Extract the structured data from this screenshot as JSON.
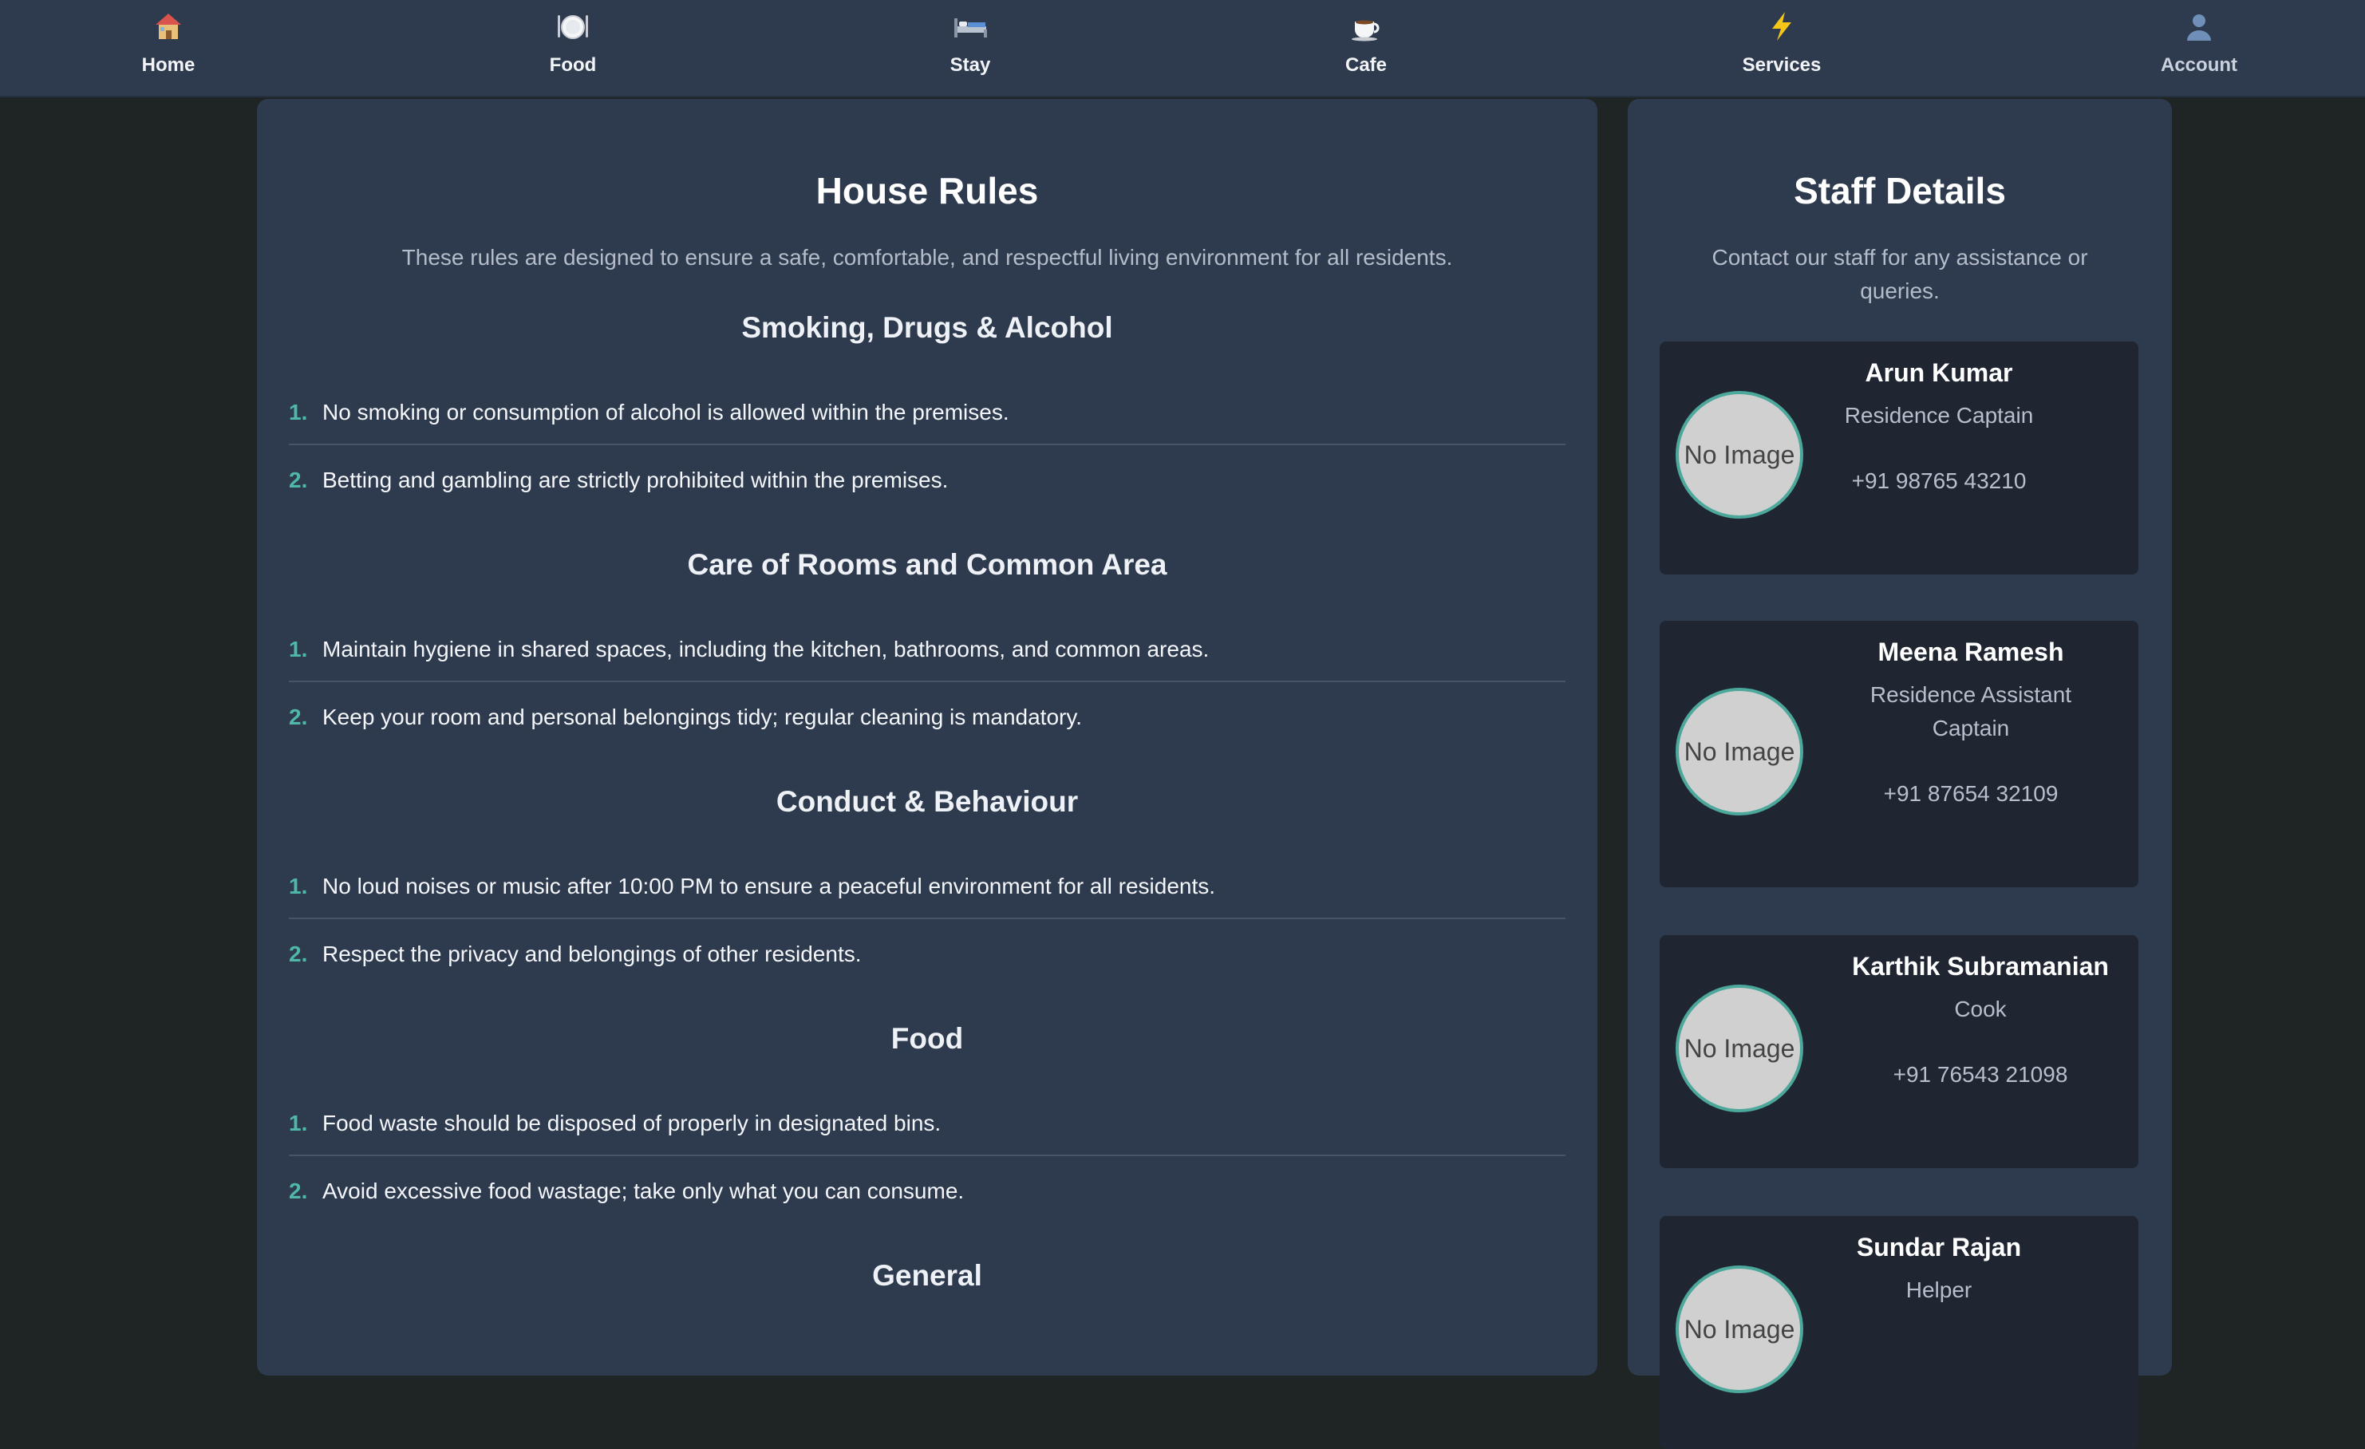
{
  "nav": {
    "items": [
      {
        "label": "Home",
        "icon": "home-icon"
      },
      {
        "label": "Food",
        "icon": "plate-icon"
      },
      {
        "label": "Stay",
        "icon": "bed-icon"
      },
      {
        "label": "Cafe",
        "icon": "coffee-icon"
      },
      {
        "label": "Services",
        "icon": "lightning-icon"
      },
      {
        "label": "Account",
        "icon": "user-icon"
      }
    ]
  },
  "rules": {
    "title": "House Rules",
    "subtitle": "These rules are designed to ensure a safe, comfortable, and respectful living environment for all residents.",
    "sections": [
      {
        "title": "Smoking, Drugs & Alcohol",
        "items": [
          {
            "num": "1.",
            "text": "No smoking or consumption of alcohol is allowed within the premises."
          },
          {
            "num": "2.",
            "text": "Betting and gambling are strictly prohibited within the premises."
          }
        ]
      },
      {
        "title": "Care of Rooms and Common Area",
        "items": [
          {
            "num": "1.",
            "text": "Maintain hygiene in shared spaces, including the kitchen, bathrooms, and common areas."
          },
          {
            "num": "2.",
            "text": "Keep your room and personal belongings tidy; regular cleaning is mandatory."
          }
        ]
      },
      {
        "title": "Conduct & Behaviour",
        "items": [
          {
            "num": "1.",
            "text": "No loud noises or music after 10:00 PM to ensure a peaceful environment for all residents."
          },
          {
            "num": "2.",
            "text": "Respect the privacy and belongings of other residents."
          }
        ]
      },
      {
        "title": "Food",
        "items": [
          {
            "num": "1.",
            "text": "Food waste should be disposed of properly in designated bins."
          },
          {
            "num": "2.",
            "text": "Avoid excessive food wastage; take only what you can consume."
          }
        ]
      },
      {
        "title": "General",
        "items": []
      }
    ]
  },
  "staff": {
    "title": "Staff Details",
    "subtitle": "Contact our staff for any assistance or queries.",
    "members": [
      {
        "name": "Arun Kumar",
        "role": "Residence Captain",
        "phone": "+91 98765 43210",
        "avatar_text": "No Image"
      },
      {
        "name": "Meena Ramesh",
        "role": "Residence Assistant Captain",
        "phone": "+91 87654 32109",
        "avatar_text": "No Image"
      },
      {
        "name": "Karthik Subramanian",
        "role": "Cook",
        "phone": "+91 76543 21098",
        "avatar_text": "No Image"
      },
      {
        "name": "Sundar Rajan",
        "role": "Helper",
        "phone": "",
        "avatar_text": "No Image"
      }
    ]
  }
}
